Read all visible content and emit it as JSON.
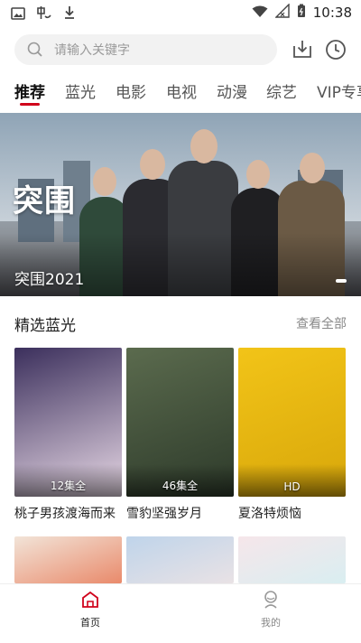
{
  "status_bar": {
    "time": "10:38",
    "left_icons": [
      "image-icon",
      "app-icon",
      "download-icon"
    ],
    "right_icons": [
      "wifi-icon",
      "signal-icon",
      "battery-icon"
    ]
  },
  "search": {
    "placeholder": "请输入关键字",
    "download_icon": "download-box-icon",
    "history_icon": "clock-icon"
  },
  "tabs": [
    {
      "label": "推荐",
      "active": true
    },
    {
      "label": "蓝光",
      "active": false
    },
    {
      "label": "电影",
      "active": false
    },
    {
      "label": "电视",
      "active": false
    },
    {
      "label": "动漫",
      "active": false
    },
    {
      "label": "综艺",
      "active": false
    },
    {
      "label": "VIP专享",
      "active": false
    }
  ],
  "banner": {
    "logo_text": "突围",
    "title": "突围2021"
  },
  "section": {
    "title": "精选蓝光",
    "more": "查看全部"
  },
  "cards": [
    {
      "title": "桃子男孩渡海而来",
      "badge": "12集全",
      "colors": [
        "#3b2f5c",
        "#e8d9e6"
      ]
    },
    {
      "title": "雪豹坚强岁月",
      "badge": "46集全",
      "colors": [
        "#5b6b4e",
        "#2d3a2a"
      ]
    },
    {
      "title": "夏洛特烦恼",
      "badge": "HD",
      "colors": [
        "#f2c418",
        "#d8a70a"
      ]
    }
  ],
  "cards_row2": [
    {
      "colors": [
        "#f2e4d8",
        "#e98a6b"
      ]
    },
    {
      "colors": [
        "#bfd4ea",
        "#e9e2e5"
      ]
    },
    {
      "colors": [
        "#f6e6ea",
        "#d9eef1"
      ]
    }
  ],
  "bottom_nav": [
    {
      "label": "首页",
      "icon": "home-icon",
      "active": true
    },
    {
      "label": "我的",
      "icon": "profile-icon",
      "active": false
    }
  ],
  "colors": {
    "accent": "#d0021b",
    "text": "#222222",
    "muted": "#888888"
  }
}
